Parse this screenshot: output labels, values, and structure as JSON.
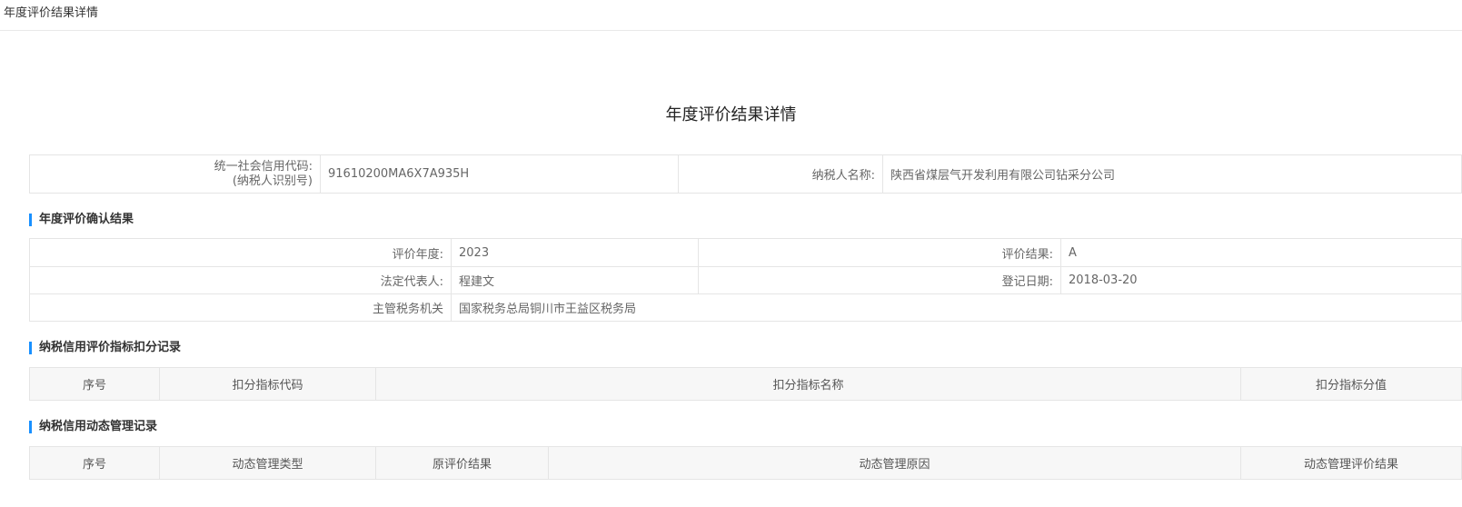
{
  "tab": {
    "title": "年度评价结果详情"
  },
  "page": {
    "title": "年度评价结果详情"
  },
  "taxpayer": {
    "credit_code_label_line1": "统一社会信用代码:",
    "credit_code_label_line2": "(纳税人识别号)",
    "credit_code_value": "91610200MA6X7A935H",
    "name_label": "纳税人名称:",
    "name_value": "陕西省煤层气开发利用有限公司钻采分公司"
  },
  "annual_result": {
    "section_title": "年度评价确认结果",
    "year_label": "评价年度:",
    "year_value": "2023",
    "result_label": "评价结果:",
    "result_value": "A",
    "legal_rep_label": "法定代表人:",
    "legal_rep_value": "程建文",
    "reg_date_label": "登记日期:",
    "reg_date_value": "2018-03-20",
    "authority_label": "主管税务机关",
    "authority_value": "国家税务总局铜川市王益区税务局"
  },
  "deduction": {
    "section_title": "纳税信用评价指标扣分记录",
    "columns": [
      "序号",
      "扣分指标代码",
      "扣分指标名称",
      "扣分指标分值"
    ]
  },
  "dynamic": {
    "section_title": "纳税信用动态管理记录",
    "columns": [
      "序号",
      "动态管理类型",
      "原评价结果",
      "动态管理原因",
      "动态管理评价结果"
    ]
  },
  "colors": {
    "accent": "#1890ff",
    "border": "#e5e5e5",
    "header_bg": "#f7f7f7"
  }
}
